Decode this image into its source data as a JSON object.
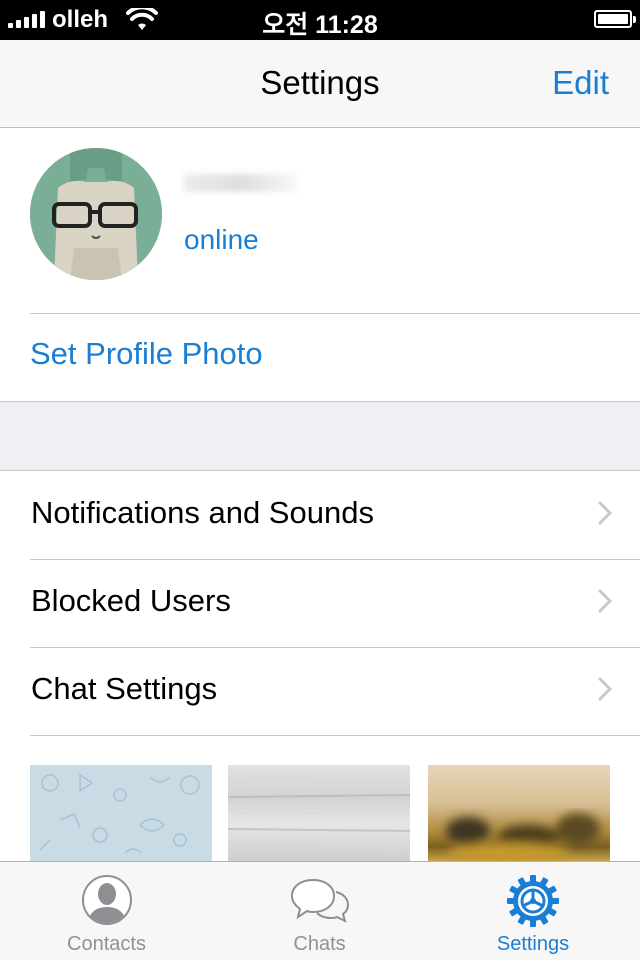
{
  "status_bar": {
    "carrier": "olleh",
    "time": "오전 11:28",
    "signal_bars": 5
  },
  "nav": {
    "title": "Settings",
    "edit_label": "Edit"
  },
  "profile": {
    "status": "online"
  },
  "set_profile_photo": "Set Profile Photo",
  "menu": [
    {
      "label": "Notifications and Sounds",
      "icon": "chevron-right-icon"
    },
    {
      "label": "Blocked Users",
      "icon": "chevron-right-icon"
    },
    {
      "label": "Chat Settings",
      "icon": "chevron-right-icon"
    }
  ],
  "tabs": [
    {
      "label": "Contacts",
      "icon": "contacts-icon",
      "active": false
    },
    {
      "label": "Chats",
      "icon": "chats-icon",
      "active": false
    },
    {
      "label": "Settings",
      "icon": "settings-gear-icon",
      "active": true
    }
  ],
  "colors": {
    "accent": "#1a7fd4",
    "nav_background": "#f7f7f8",
    "section_gap": "#efeff4",
    "inactive_tab": "#929292"
  }
}
